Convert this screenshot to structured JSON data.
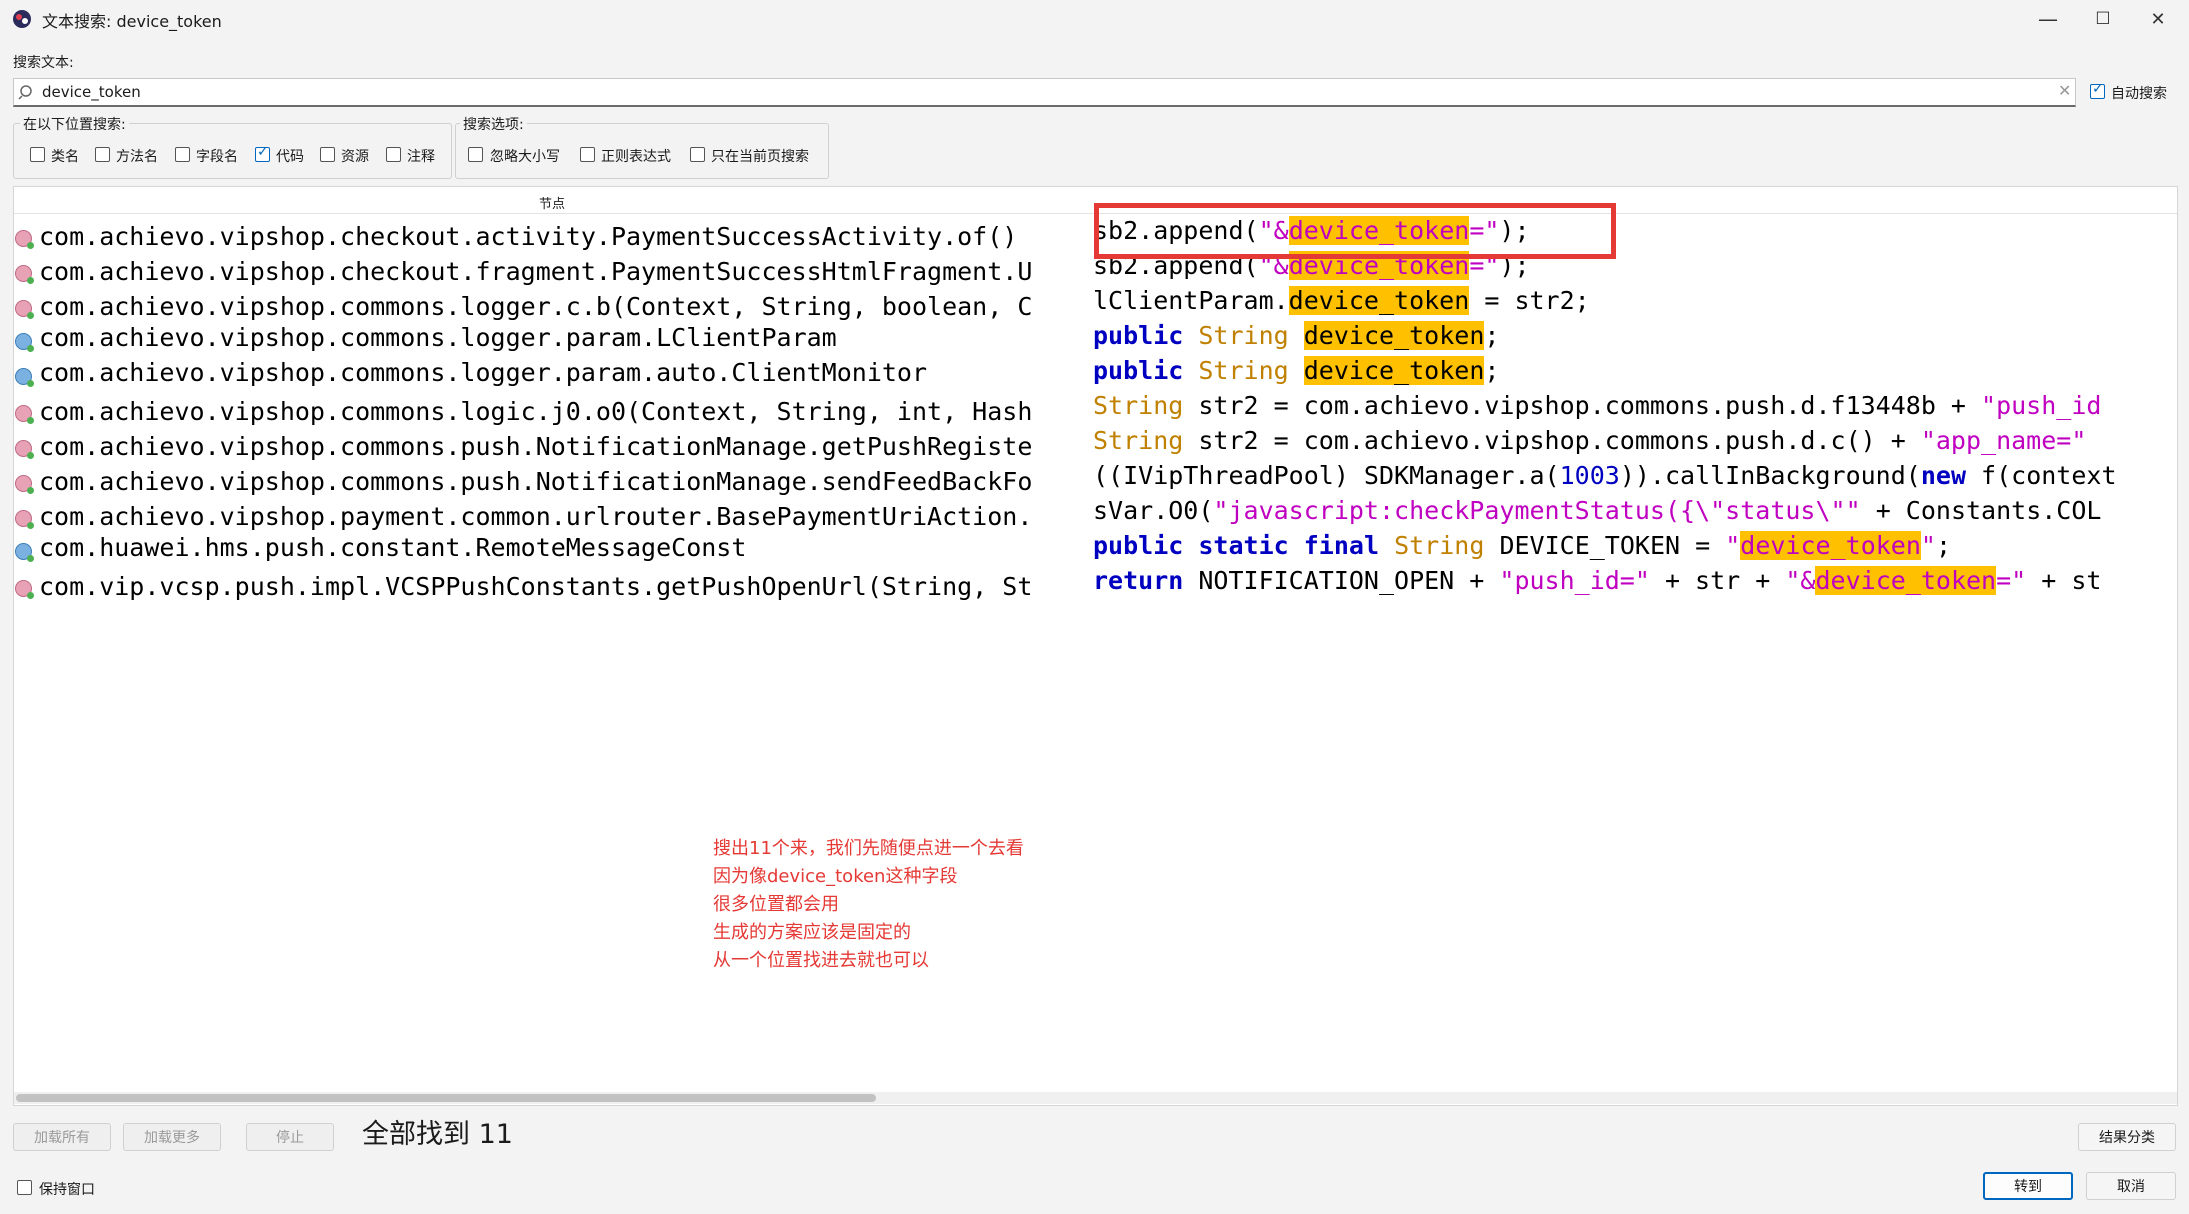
{
  "window": {
    "title": "文本搜索: device_token",
    "minimize": "—",
    "maximize": "☐",
    "close": "✕"
  },
  "search": {
    "label": "搜索文本:",
    "value": "device_token",
    "auto_search_label": "自动搜索",
    "auto_search_checked": true
  },
  "locations": {
    "title": "在以下位置搜索:",
    "items": [
      {
        "label": "类名",
        "checked": false
      },
      {
        "label": "方法名",
        "checked": false
      },
      {
        "label": "字段名",
        "checked": false
      },
      {
        "label": "代码",
        "checked": true
      },
      {
        "label": "资源",
        "checked": false
      },
      {
        "label": "注释",
        "checked": false
      }
    ]
  },
  "options": {
    "title": "搜索选项:",
    "items": [
      {
        "label": "忽略大小写",
        "checked": false
      },
      {
        "label": "正则表达式",
        "checked": false
      },
      {
        "label": "只在当前页搜索",
        "checked": false
      }
    ]
  },
  "results": {
    "column_header": "节点",
    "rows": [
      {
        "icon": "method",
        "node": "com.achievo.vipshop.checkout.activity.PaymentSuccessActivity.of()"
      },
      {
        "icon": "method",
        "node": "com.achievo.vipshop.checkout.fragment.PaymentSuccessHtmlFragment.U"
      },
      {
        "icon": "method",
        "node": "com.achievo.vipshop.commons.logger.c.b(Context, String, boolean, C"
      },
      {
        "icon": "class",
        "node": "com.achievo.vipshop.commons.logger.param.LClientParam"
      },
      {
        "icon": "class",
        "node": "com.achievo.vipshop.commons.logger.param.auto.ClientMonitor"
      },
      {
        "icon": "method",
        "node": "com.achievo.vipshop.commons.logic.j0.o0(Context, String, int, Hash"
      },
      {
        "icon": "method",
        "node": "com.achievo.vipshop.commons.push.NotificationManage.getPushRegiste"
      },
      {
        "icon": "method",
        "node": "com.achievo.vipshop.commons.push.NotificationManage.sendFeedBackFo"
      },
      {
        "icon": "method",
        "node": "com.achievo.vipshop.payment.common.urlrouter.BasePaymentUriAction."
      },
      {
        "icon": "class",
        "node": "com.huawei.hms.push.constant.RemoteMessageConst"
      },
      {
        "icon": "method",
        "node": "com.vip.vcsp.push.impl.VCSPPushConstants.getPushOpenUrl(String, St"
      }
    ],
    "code": {
      "r0": [
        "sb2.append(",
        "\"&",
        "device_token",
        "=\"",
        ");"
      ],
      "r1": [
        "sb2.append(",
        "\"&",
        "device_token",
        "=\"",
        ");"
      ],
      "r2": [
        "lClientParam.",
        "device_token",
        " = str2;"
      ],
      "r3": [
        "public",
        " ",
        "String",
        " ",
        "device_token",
        ";"
      ],
      "r4": [
        "public",
        " ",
        "String",
        " ",
        "device_token",
        ";"
      ],
      "r5": [
        "String",
        " str2 = com.achievo.vipshop.commons.push.d.f13448b + ",
        "\"push_id"
      ],
      "r6": [
        "String",
        " str2 = com.achievo.vipshop.commons.push.d.c() + ",
        "\"app_name=\""
      ],
      "r7": [
        "((IVipThreadPool) SDKManager.a(",
        "1003",
        ")).callInBackground(",
        "new",
        " f(context"
      ],
      "r8": [
        "sVar.O0(",
        "\"javascript:checkPaymentStatus({\\\"status\\\"\"",
        " + Constants.COL"
      ],
      "r9": [
        "public",
        " ",
        "static",
        " ",
        "final",
        " ",
        "String",
        " DEVICE_TOKEN = ",
        "\"",
        "device_token",
        "\"",
        ";"
      ],
      "r10": [
        "return",
        " NOTIFICATION_OPEN + ",
        "\"push_id=\"",
        " + str + ",
        "\"&",
        "device_token",
        "=\"",
        " + st"
      ]
    }
  },
  "annotation": [
    "搜出11个来，我们先随便点进一个去看",
    "因为像device_token这种字段",
    "很多位置都会用",
    "生成的方案应该是固定的",
    "从一个位置找进去就也可以"
  ],
  "footer": {
    "load_all": "加载所有",
    "load_more": "加载更多",
    "stop": "停止",
    "found_text": "全部找到  11",
    "group_results": "结果分类",
    "keep_window": "保持窗口",
    "goto": "转到",
    "cancel": "取消"
  }
}
